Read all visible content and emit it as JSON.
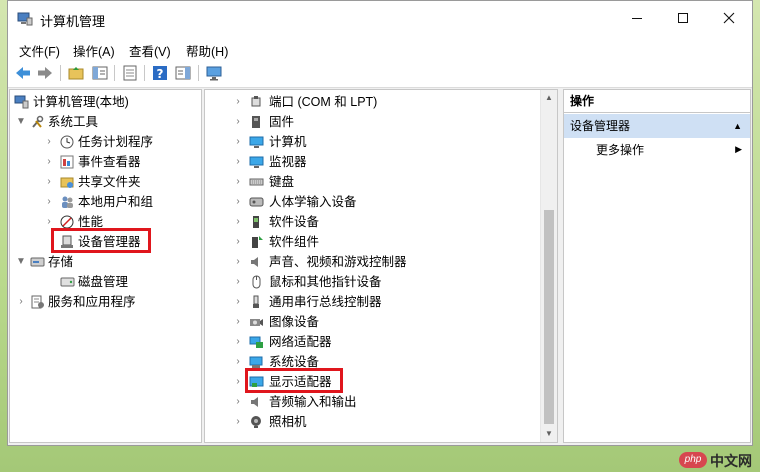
{
  "window": {
    "title": "计算机管理"
  },
  "menubar": [
    {
      "label": "文件(F)"
    },
    {
      "label": "操作(A)"
    },
    {
      "label": "查看(V)"
    },
    {
      "label": "帮助(H)"
    }
  ],
  "toolbar": [
    "back-arrow-icon",
    "forward-arrow-icon",
    "up-folder-icon",
    "console-tree-icon",
    "properties-icon",
    "help-icon",
    "show-hide-pane-icon",
    "monitor-icon"
  ],
  "left_tree": [
    {
      "label": "计算机管理(本地)",
      "icon": "computer-management-icon"
    },
    {
      "label": "系统工具",
      "icon": "tools-icon",
      "expanded": true
    },
    {
      "label": "任务计划程序",
      "icon": "clock-icon"
    },
    {
      "label": "事件查看器",
      "icon": "event-viewer-icon"
    },
    {
      "label": "共享文件夹",
      "icon": "shared-folder-icon"
    },
    {
      "label": "本地用户和组",
      "icon": "users-icon"
    },
    {
      "label": "性能",
      "icon": "performance-icon"
    },
    {
      "label": "设备管理器",
      "icon": "device-manager-icon",
      "highlighted": true
    },
    {
      "label": "存储",
      "icon": "storage-icon",
      "expanded": true
    },
    {
      "label": "磁盘管理",
      "icon": "disk-icon"
    },
    {
      "label": "服务和应用程序",
      "icon": "services-icon"
    }
  ],
  "device_list": [
    {
      "label": "端口 (COM 和 LPT)",
      "icon": "port-icon"
    },
    {
      "label": "固件",
      "icon": "firmware-icon"
    },
    {
      "label": "计算机",
      "icon": "computer-icon"
    },
    {
      "label": "监视器",
      "icon": "monitor-icon"
    },
    {
      "label": "键盘",
      "icon": "keyboard-icon"
    },
    {
      "label": "人体学输入设备",
      "icon": "hid-icon"
    },
    {
      "label": "软件设备",
      "icon": "software-device-icon"
    },
    {
      "label": "软件组件",
      "icon": "software-component-icon"
    },
    {
      "label": "声音、视频和游戏控制器",
      "icon": "speaker-icon"
    },
    {
      "label": "鼠标和其他指针设备",
      "icon": "mouse-icon"
    },
    {
      "label": "通用串行总线控制器",
      "icon": "usb-icon"
    },
    {
      "label": "图像设备",
      "icon": "camera-device-icon"
    },
    {
      "label": "网络适配器",
      "icon": "network-adapter-icon"
    },
    {
      "label": "系统设备",
      "icon": "system-device-icon"
    },
    {
      "label": "显示适配器",
      "icon": "display-adapter-icon",
      "highlighted": true
    },
    {
      "label": "音频输入和输出",
      "icon": "audio-io-icon"
    },
    {
      "label": "照相机",
      "icon": "webcam-icon"
    }
  ],
  "actions": {
    "header": "操作",
    "section": "设备管理器",
    "more": "更多操作"
  },
  "watermark": {
    "badge": "php",
    "text": "中文网"
  },
  "colors": {
    "highlight": "#e0161d",
    "section_bg": "#cfe0f4"
  }
}
